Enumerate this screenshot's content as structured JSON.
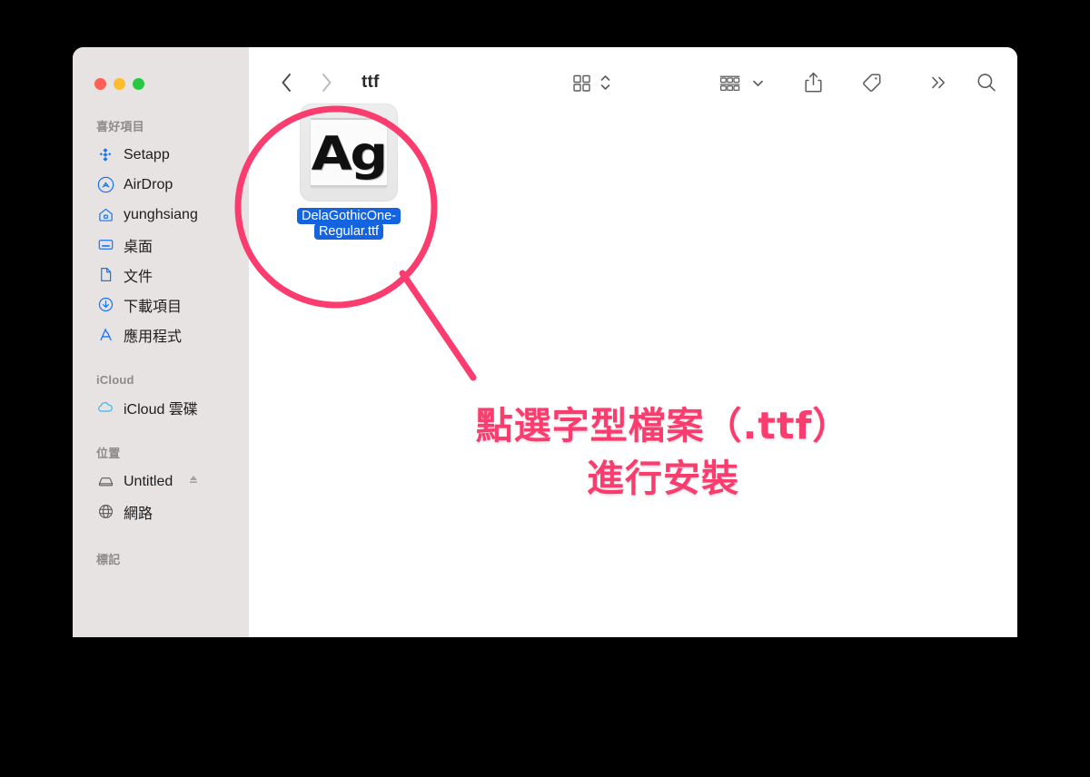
{
  "window": {
    "title": "ttf",
    "traffic_lights": [
      {
        "name": "close",
        "color": "#ff6159"
      },
      {
        "name": "minimize",
        "color": "#ffbd2e"
      },
      {
        "name": "zoom",
        "color": "#28c941"
      }
    ]
  },
  "toolbar": {
    "back_label": "back",
    "forward_label": "forward",
    "view_icon": "grid-view-icon",
    "view_stepper_icon": "chevron-up-down-icon",
    "group_icon": "group-by-icon",
    "group_chevron_icon": "chevron-down-icon",
    "share_icon": "share-icon",
    "tag_icon": "tag-icon",
    "more_icon": "double-chevron-right-icon",
    "search_icon": "search-icon"
  },
  "sidebar": {
    "sections": [
      {
        "title": "喜好項目",
        "items": [
          {
            "label": "Setapp",
            "icon": "setapp-icon"
          },
          {
            "label": "AirDrop",
            "icon": "airdrop-icon"
          },
          {
            "label": "yunghsiang",
            "icon": "home-icon"
          },
          {
            "label": "桌面",
            "icon": "desktop-icon"
          },
          {
            "label": "文件",
            "icon": "document-icon"
          },
          {
            "label": "下載項目",
            "icon": "downloads-icon"
          },
          {
            "label": "應用程式",
            "icon": "applications-icon"
          }
        ]
      },
      {
        "title": "iCloud",
        "items": [
          {
            "label": "iCloud 雲碟",
            "icon": "cloud-icon"
          }
        ]
      },
      {
        "title": "位置",
        "items": [
          {
            "label": "Untitled",
            "icon": "external-drive-icon",
            "accessory": "eject-icon"
          },
          {
            "label": "網路",
            "icon": "network-globe-icon"
          }
        ]
      },
      {
        "title": "標記",
        "items": []
      }
    ]
  },
  "main": {
    "file": {
      "name_line1": "DelaGothicOne-",
      "name_line2": "Regular.ttf",
      "full_name": "DelaGothicOne-Regular.ttf",
      "preview_text": "Ag",
      "selected": true,
      "selection_color": "#1464e0"
    }
  },
  "annotation": {
    "line1": "點選字型檔案（.ttf）",
    "line2": "進行安裝",
    "color": "#fa3c6e",
    "outline_color": "#ffffff",
    "highlight_shape": "circle",
    "pointer_shape": "line"
  }
}
